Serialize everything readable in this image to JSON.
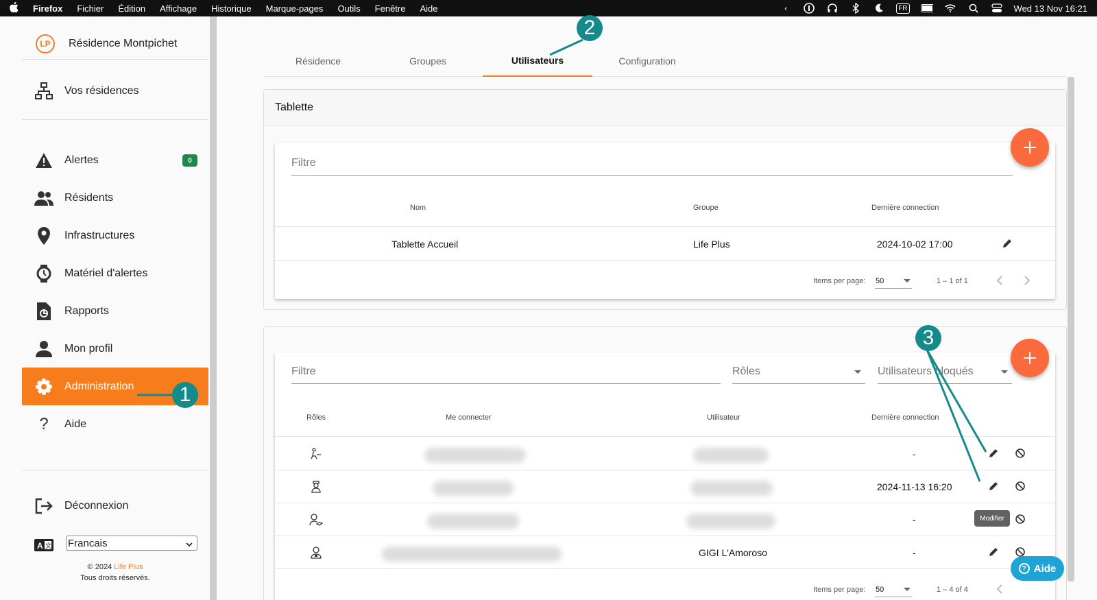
{
  "menubar": {
    "app": "Firefox",
    "menus": [
      "Fichier",
      "Édition",
      "Affichage",
      "Historique",
      "Marque-pages",
      "Outils",
      "Fenêtre",
      "Aide"
    ],
    "input_source": "FR",
    "datetime": "Wed 13 Nov  16:21"
  },
  "sidebar": {
    "brand": "Résidence Montpichet",
    "logo_text": "LP",
    "residences": "Vos résidences",
    "items": [
      {
        "label": "Alertes",
        "icon": "warning-icon",
        "badge": "0"
      },
      {
        "label": "Résidents",
        "icon": "people-icon"
      },
      {
        "label": "Infrastructures",
        "icon": "location-pin-icon"
      },
      {
        "label": "Matériel d'alertes",
        "icon": "watch-icon"
      },
      {
        "label": "Rapports",
        "icon": "report-icon"
      },
      {
        "label": "Mon profil",
        "icon": "person-icon"
      },
      {
        "label": "Administration",
        "icon": "gear-icon",
        "active": true
      },
      {
        "label": "Aide",
        "icon": "question-icon"
      }
    ],
    "logout": "Déconnexion",
    "language": "Francais",
    "footer_copyright_prefix": "© 2024 ",
    "footer_brand": "Life Plus",
    "footer_rights": "Tous droits réservés."
  },
  "tabs": [
    {
      "label": "Résidence"
    },
    {
      "label": "Groupes"
    },
    {
      "label": "Utilisateurs",
      "active": true
    },
    {
      "label": "Configuration"
    }
  ],
  "tablet_panel": {
    "title": "Tablette",
    "filter_placeholder": "Filtre",
    "columns": [
      "Nom",
      "Groupe",
      "Dernière connection"
    ],
    "rows": [
      {
        "nom": "Tablette Accueil",
        "groupe": "Life Plus",
        "derniere": "2024-10-02 17:00"
      }
    ],
    "items_per_page_label": "Items per page:",
    "items_per_page": "50",
    "range": "1 – 1 of 1"
  },
  "users_panel": {
    "filter_placeholder": "Filtre",
    "roles_placeholder": "Rôles",
    "blocked_placeholder": "Utilisateurs bloqués",
    "columns": [
      "Rôles",
      "Me connecter",
      "Utilisateur",
      "Dernière connection"
    ],
    "rows": [
      {
        "utilisateur": "",
        "derniere": "-"
      },
      {
        "utilisateur": "",
        "derniere": "2024-11-13 16:20"
      },
      {
        "utilisateur": "",
        "derniere": "-"
      },
      {
        "utilisateur": "GIGI L'Amoroso",
        "derniere": "-"
      }
    ],
    "tooltip": "Modifier",
    "items_per_page_label": "Items per page:",
    "items_per_page": "50",
    "range": "1 – 4 of 4"
  },
  "help_button": "Aide",
  "annotations": [
    "1",
    "2",
    "3"
  ],
  "colors": {
    "accent": "#f77c1b",
    "fab": "#fb6a3c",
    "annotation": "#148a8a",
    "help": "#1ea5d6",
    "badge": "#1d8a4a"
  }
}
